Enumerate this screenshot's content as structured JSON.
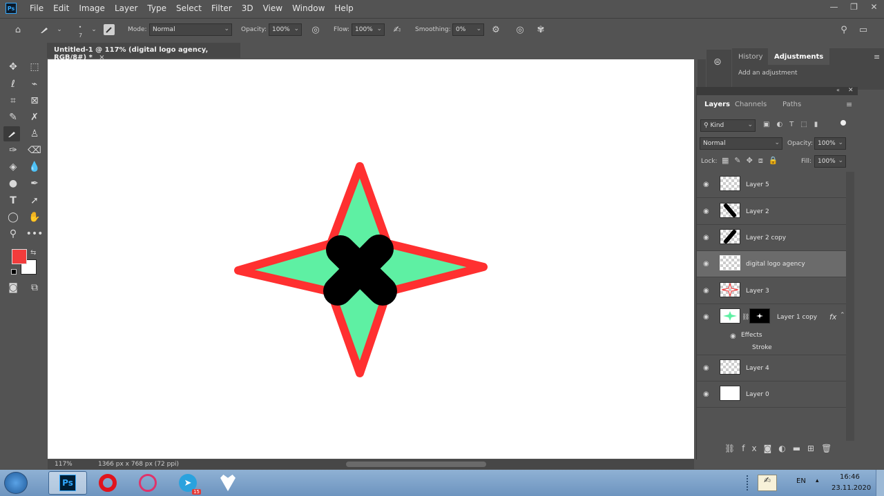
{
  "menu": {
    "app_icon": "Ps",
    "items": [
      "File",
      "Edit",
      "Image",
      "Layer",
      "Type",
      "Select",
      "Filter",
      "3D",
      "View",
      "Window",
      "Help"
    ]
  },
  "window_controls": {
    "minimize": "—",
    "restore": "❐",
    "close": "✕"
  },
  "options_bar": {
    "brush_size": "7",
    "mode_label": "Mode:",
    "mode_value": "Normal",
    "opacity_label": "Opacity:",
    "opacity_value": "100%",
    "flow_label": "Flow:",
    "flow_value": "100%",
    "smoothing_label": "Smoothing:",
    "smoothing_value": "0%"
  },
  "document": {
    "tab_title": "Untitled-1 @ 117% (digital logo agency, RGB/8#) *",
    "close": "×",
    "zoom": "117%",
    "doc_info": "1366 px x 768 px (72 ppi)"
  },
  "colors": {
    "foreground": "#f23c3c",
    "background": "#ffffff",
    "star_fill": "#5ef0a3",
    "star_stroke": "#ff3030",
    "cross_fill": "#000000",
    "selected_layer": "#6b6b6b"
  },
  "adjustments_panel": {
    "tabs": [
      "History",
      "Adjustments"
    ],
    "active_tab": "Adjustments",
    "hint": "Add an adjustment"
  },
  "layers_panel": {
    "tabs": [
      "Layers",
      "Channels",
      "Paths"
    ],
    "active_tab": "Layers",
    "filter_label": "Kind",
    "blend_mode": "Normal",
    "opacity_label": "Opacity:",
    "opacity_value": "100%",
    "lock_label": "Lock:",
    "fill_label": "Fill:",
    "fill_value": "100%",
    "layers": [
      {
        "name": "Layer 5",
        "thumb": "checker"
      },
      {
        "name": "Layer 2",
        "thumb": "stroke-down"
      },
      {
        "name": "Layer 2 copy",
        "thumb": "stroke-up"
      },
      {
        "name": "digital logo agency",
        "thumb": "checker",
        "selected": true
      },
      {
        "name": "Layer 3",
        "thumb": "star-outline"
      },
      {
        "name": "Layer 1 copy",
        "thumb": "star-fill",
        "fx": "fx"
      },
      {
        "name": "Layer 4",
        "thumb": "checker"
      },
      {
        "name": "Layer 0",
        "thumb": "white"
      }
    ],
    "effects_label": "Effects",
    "stroke_label": "Stroke"
  },
  "taskbar": {
    "lang": "EN",
    "time": "16:46",
    "date": "23.11.2020",
    "telegram_badge": "15"
  }
}
